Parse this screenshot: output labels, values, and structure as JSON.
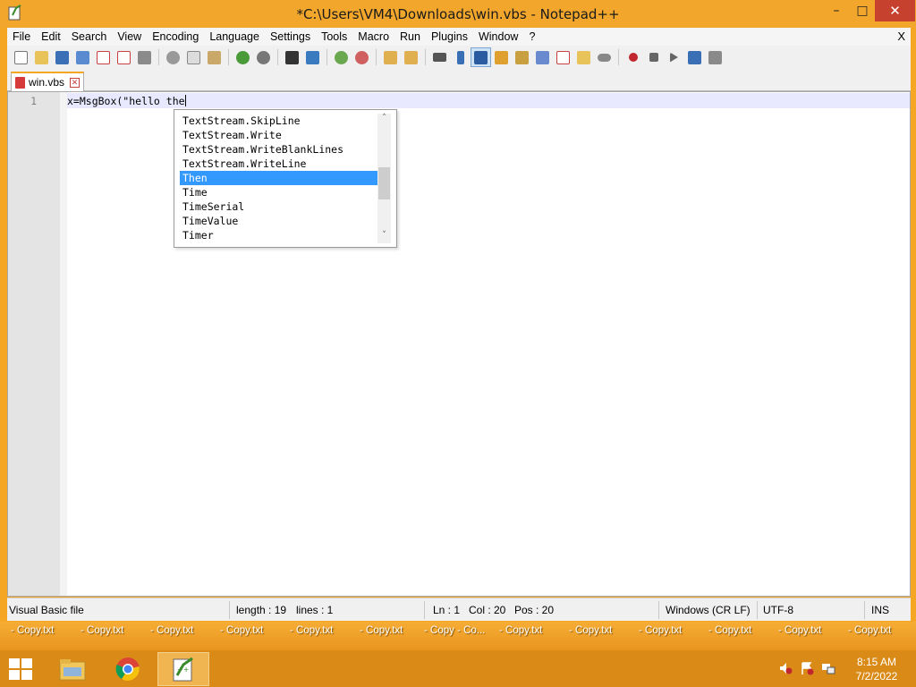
{
  "window": {
    "title": "*C:\\Users\\VM4\\Downloads\\win.vbs - Notepad++"
  },
  "window_controls": {
    "minimize": "–",
    "maximize": "□",
    "close": "✕"
  },
  "menu": {
    "items": [
      "File",
      "Edit",
      "Search",
      "View",
      "Encoding",
      "Language",
      "Settings",
      "Tools",
      "Macro",
      "Run",
      "Plugins",
      "Window",
      "?"
    ],
    "close_label": "X"
  },
  "tabs": [
    {
      "label": "win.vbs"
    }
  ],
  "editor": {
    "line_number": "1",
    "code_line": "x=MsgBox(\"hello the"
  },
  "autocomplete": {
    "items": [
      "TextStream.SkipLine",
      "TextStream.Write",
      "TextStream.WriteBlankLines",
      "TextStream.WriteLine",
      "Then",
      "Time",
      "TimeSerial",
      "TimeValue",
      "Timer"
    ],
    "selected": "Then",
    "scroll_up": "˄",
    "scroll_down": "˅"
  },
  "status": {
    "file_type": "Visual Basic file",
    "length": "length : 19",
    "lines": "lines : 1",
    "ln": "Ln : 1",
    "col": "Col : 20",
    "pos": "Pos : 20",
    "eol": "Windows (CR LF)",
    "encoding": "UTF-8",
    "mode": "INS"
  },
  "desktop_labels": [
    "- Copy.txt",
    "- Copy.txt",
    "- Copy.txt",
    "- Copy.txt",
    "- Copy.txt",
    "- Copy.txt",
    "- Copy - Co...",
    "- Copy.txt",
    "- Copy.txt",
    "- Copy.txt",
    "- Copy.txt",
    "- Copy.txt",
    "- Copy.txt"
  ],
  "taskbar": {
    "time": "8:15 AM",
    "date": "7/2/2022"
  },
  "colors": {
    "accent": "#f5a623",
    "selection": "#3399ff",
    "close": "#c7412f"
  }
}
